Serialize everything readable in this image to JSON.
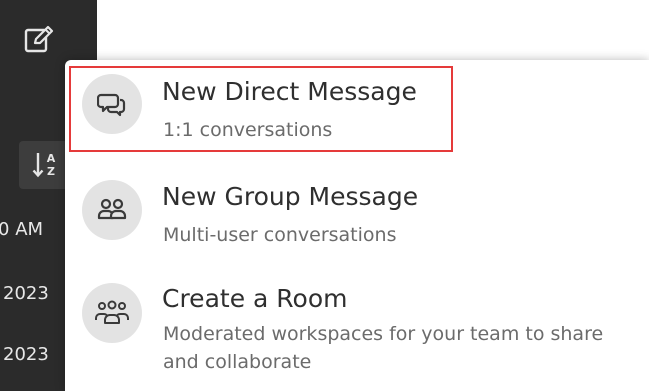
{
  "sidebar": {
    "time_fragment": "AM",
    "time_fragment_prefix": "0",
    "date_fragment_1": "2023",
    "date_fragment_2": "2023",
    "sort_icon_label": "A-Z sort"
  },
  "menu": {
    "items": [
      {
        "title": "New Direct Message",
        "subtitle": "1:1 conversations",
        "icon": "chat-bubbles-icon"
      },
      {
        "title": "New Group Message",
        "subtitle": "Multi-user conversations",
        "icon": "group-icon"
      },
      {
        "title": "Create a Room",
        "subtitle": "Moderated workspaces for your team to share and collaborate",
        "icon": "room-icon"
      }
    ]
  },
  "colors": {
    "sidebar_bg": "#2b2b2b",
    "highlight": "#e53a3a",
    "icon_circle": "#e3e3e3"
  }
}
